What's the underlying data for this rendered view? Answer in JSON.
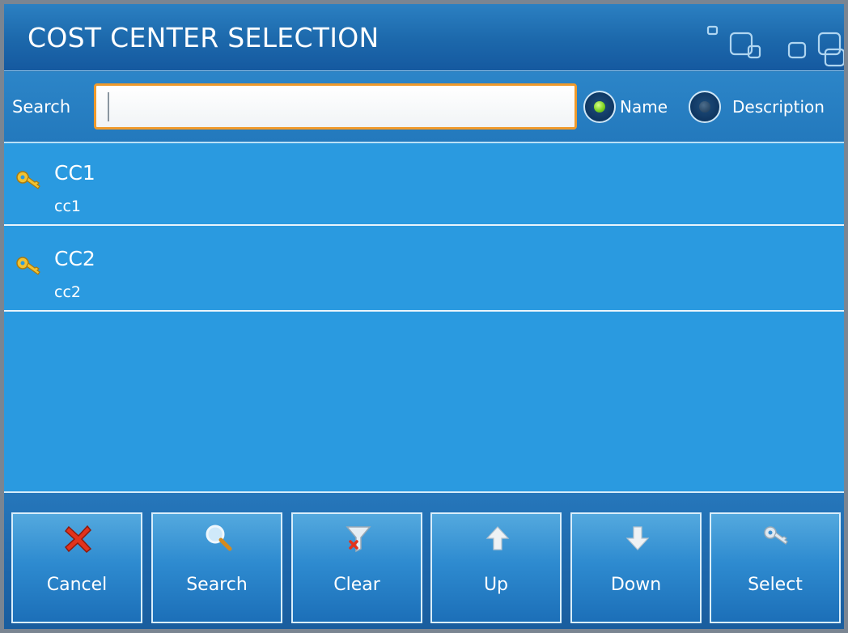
{
  "window": {
    "title": "COST CENTER SELECTION"
  },
  "search": {
    "label": "Search",
    "value": "",
    "placeholder": "",
    "options": [
      {
        "label": "Name",
        "selected": true
      },
      {
        "label": "Description",
        "selected": false
      }
    ]
  },
  "list": {
    "items": [
      {
        "name": "CC1",
        "description": "cc1",
        "icon": "key-icon"
      },
      {
        "name": "CC2",
        "description": "cc2",
        "icon": "key-icon"
      }
    ]
  },
  "toolbar": {
    "buttons": [
      {
        "label": "Cancel",
        "icon": "cancel-icon"
      },
      {
        "label": "Search",
        "icon": "magnifier-icon"
      },
      {
        "label": "Clear",
        "icon": "filter-clear-icon"
      },
      {
        "label": "Up",
        "icon": "arrow-up-icon"
      },
      {
        "label": "Down",
        "icon": "arrow-down-icon"
      },
      {
        "label": "Select",
        "icon": "key-icon"
      }
    ]
  },
  "colors": {
    "accent": "#2a9ae0",
    "input_border": "#ef9a2c",
    "radio_on": "#7ed321",
    "key_icon": "#f2c230",
    "cancel_icon": "#e2331c"
  }
}
